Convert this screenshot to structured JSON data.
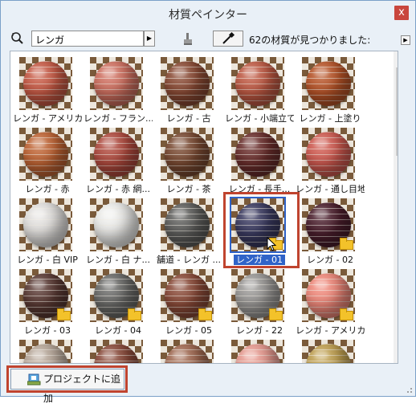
{
  "window": {
    "title": "材質ペインター",
    "close_label": "x"
  },
  "toolbar": {
    "search_value": "レンガ",
    "search_arrow": "▶",
    "result_count": "62の材質が見つかりました:",
    "menu_arrow": "▶"
  },
  "scrollbar": {
    "up": "▲",
    "down": "▼"
  },
  "materials": [
    {
      "label": "レンガ - アメリカ...",
      "color": "#c85a45",
      "folder": false,
      "selected": false
    },
    {
      "label": "レンガ - フラン...",
      "color": "#d07060",
      "folder": false,
      "selected": false
    },
    {
      "label": "レンガ - 古",
      "color": "#8a4a34",
      "folder": false,
      "selected": false
    },
    {
      "label": "レンガ - 小端立て",
      "color": "#c05a44",
      "folder": false,
      "selected": false
    },
    {
      "label": "レンガ - 上塗り",
      "color": "#b85428",
      "folder": false,
      "selected": false
    },
    {
      "label": "レンガ - 赤",
      "color": "#c06434",
      "folder": false,
      "selected": false
    },
    {
      "label": "レンガ - 赤 網...",
      "color": "#b04a3e",
      "folder": false,
      "selected": false
    },
    {
      "label": "レンガ - 茶",
      "color": "#7a4a32",
      "folder": false,
      "selected": false
    },
    {
      "label": "レンガ - 長手...",
      "color": "#6a2e2c",
      "folder": false,
      "selected": false
    },
    {
      "label": "レンガ - 通し目地",
      "color": "#d05a50",
      "folder": false,
      "selected": false
    },
    {
      "label": "レンガ - 白 VIP",
      "color": "#e4e2e0",
      "folder": false,
      "selected": false
    },
    {
      "label": "レンガ - 白 ナ...",
      "color": "#eeeeec",
      "folder": false,
      "selected": false
    },
    {
      "label": "舗道 - レンガ ...",
      "color": "#5e5e5c",
      "folder": false,
      "selected": false
    },
    {
      "label": "レンガ - 01",
      "color": "#3a3a60",
      "folder": true,
      "selected": true
    },
    {
      "label": "レンガ - 02",
      "color": "#4a1e2c",
      "folder": true,
      "selected": false
    },
    {
      "label": "レンガ - 03",
      "color": "#5a3a34",
      "folder": true,
      "selected": false
    },
    {
      "label": "レンガ - 04",
      "color": "#6a6a68",
      "folder": true,
      "selected": false
    },
    {
      "label": "レンガ - 05",
      "color": "#8a4a38",
      "folder": true,
      "selected": false
    },
    {
      "label": "レンガ - 22",
      "color": "#9a9896",
      "folder": true,
      "selected": false
    },
    {
      "label": "レンガ - アメリカ...",
      "color": "#f0887a",
      "folder": true,
      "selected": false
    },
    {
      "label": "",
      "color": "#b8a89a",
      "folder": false,
      "selected": false
    },
    {
      "label": "",
      "color": "#8a4a3a",
      "folder": false,
      "selected": false
    },
    {
      "label": "",
      "color": "#a06850",
      "folder": false,
      "selected": false
    },
    {
      "label": "",
      "color": "#e89a90",
      "folder": false,
      "selected": false
    },
    {
      "label": "",
      "color": "#c0a050",
      "folder": false,
      "selected": false
    }
  ],
  "footer": {
    "add_to_project_label": "プロジェクトに追加"
  }
}
